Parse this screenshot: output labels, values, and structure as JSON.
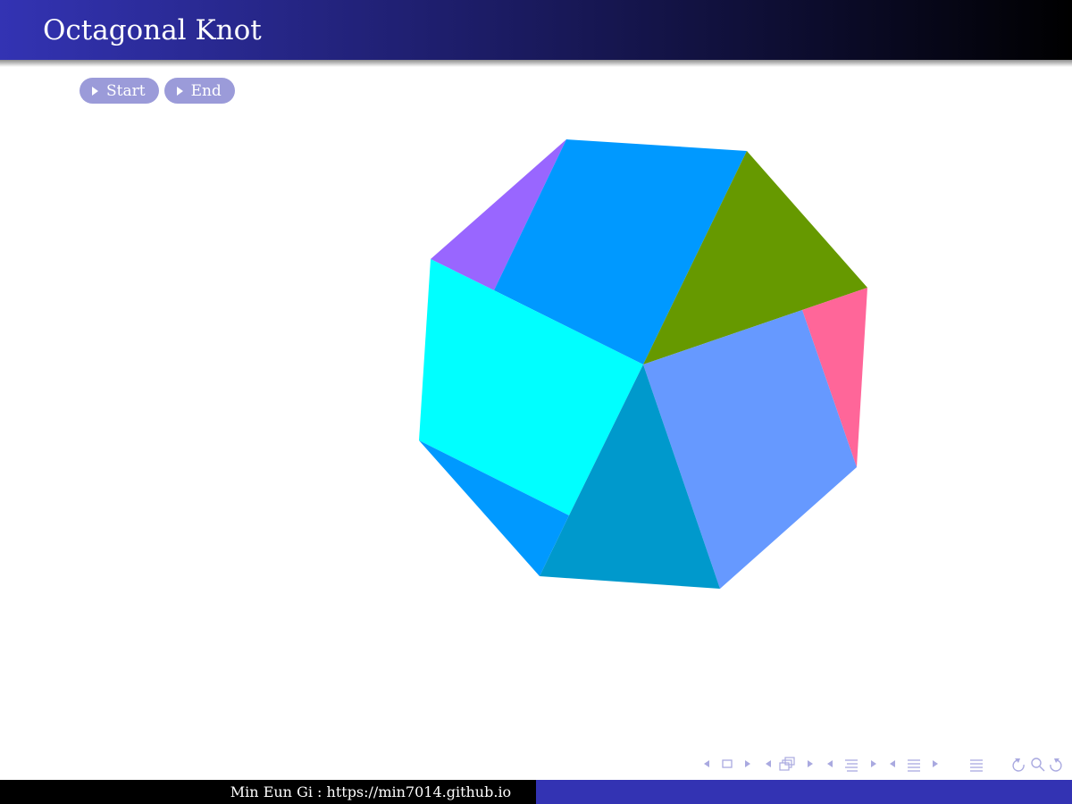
{
  "header": {
    "title": "Octagonal Knot"
  },
  "buttons": [
    {
      "label": "Start"
    },
    {
      "label": "End"
    }
  ],
  "footer": {
    "author_text": "Min Eun Gi : https://min7014.github.io"
  },
  "figure": {
    "colors": {
      "purple": "#9966ff",
      "blue": "#0099ff",
      "olive": "#669900",
      "pink": "#ff6699",
      "cyan": "#00ffff",
      "periwinkle": "#6699ff",
      "teal": "#0099cc"
    }
  },
  "theme": {
    "header_start": "#3333b3",
    "header_end": "#000000",
    "button_bg": "#9b9bd9",
    "nav_symbol_color": "#a9a9e0",
    "footer_left": "#000000",
    "footer_right": "#3333b3"
  }
}
